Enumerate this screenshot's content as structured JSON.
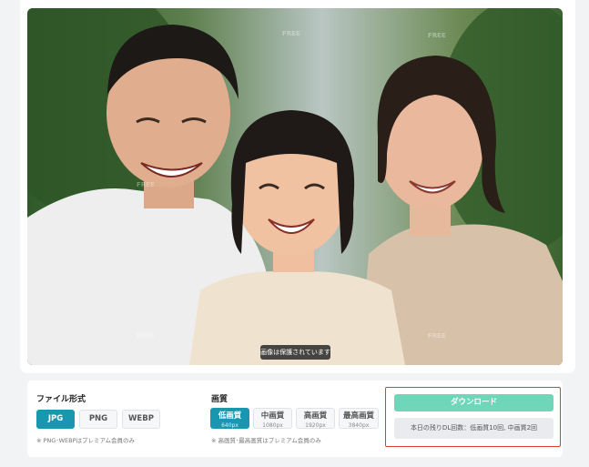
{
  "photo": {
    "alt": "family-photo",
    "protect_badge": "画像は保護されています",
    "watermark": "FREE"
  },
  "format": {
    "title": "ファイル形式",
    "options": [
      {
        "label": "JPG",
        "selected": true
      },
      {
        "label": "PNG",
        "selected": false
      },
      {
        "label": "WEBP",
        "selected": false
      }
    ],
    "note": "※ PNG･WEBPはプレミアム会員のみ"
  },
  "quality": {
    "title": "画質",
    "options": [
      {
        "label": "低画質",
        "size": "640px",
        "selected": true
      },
      {
        "label": "中画質",
        "size": "1080px",
        "selected": false
      },
      {
        "label": "高画質",
        "size": "1920px",
        "selected": false
      },
      {
        "label": "最高画質",
        "size": "3840px",
        "selected": false
      }
    ],
    "note": "※ 高画質･最高画質はプレミアム会員のみ"
  },
  "download": {
    "button_label": "ダウンロード",
    "remaining": "本日の残りDL回数：低画質10回, 中画質2回"
  },
  "colors": {
    "accent": "#1a97b0",
    "download": "#6fd6b9",
    "highlight_border": "#e23b3b"
  }
}
